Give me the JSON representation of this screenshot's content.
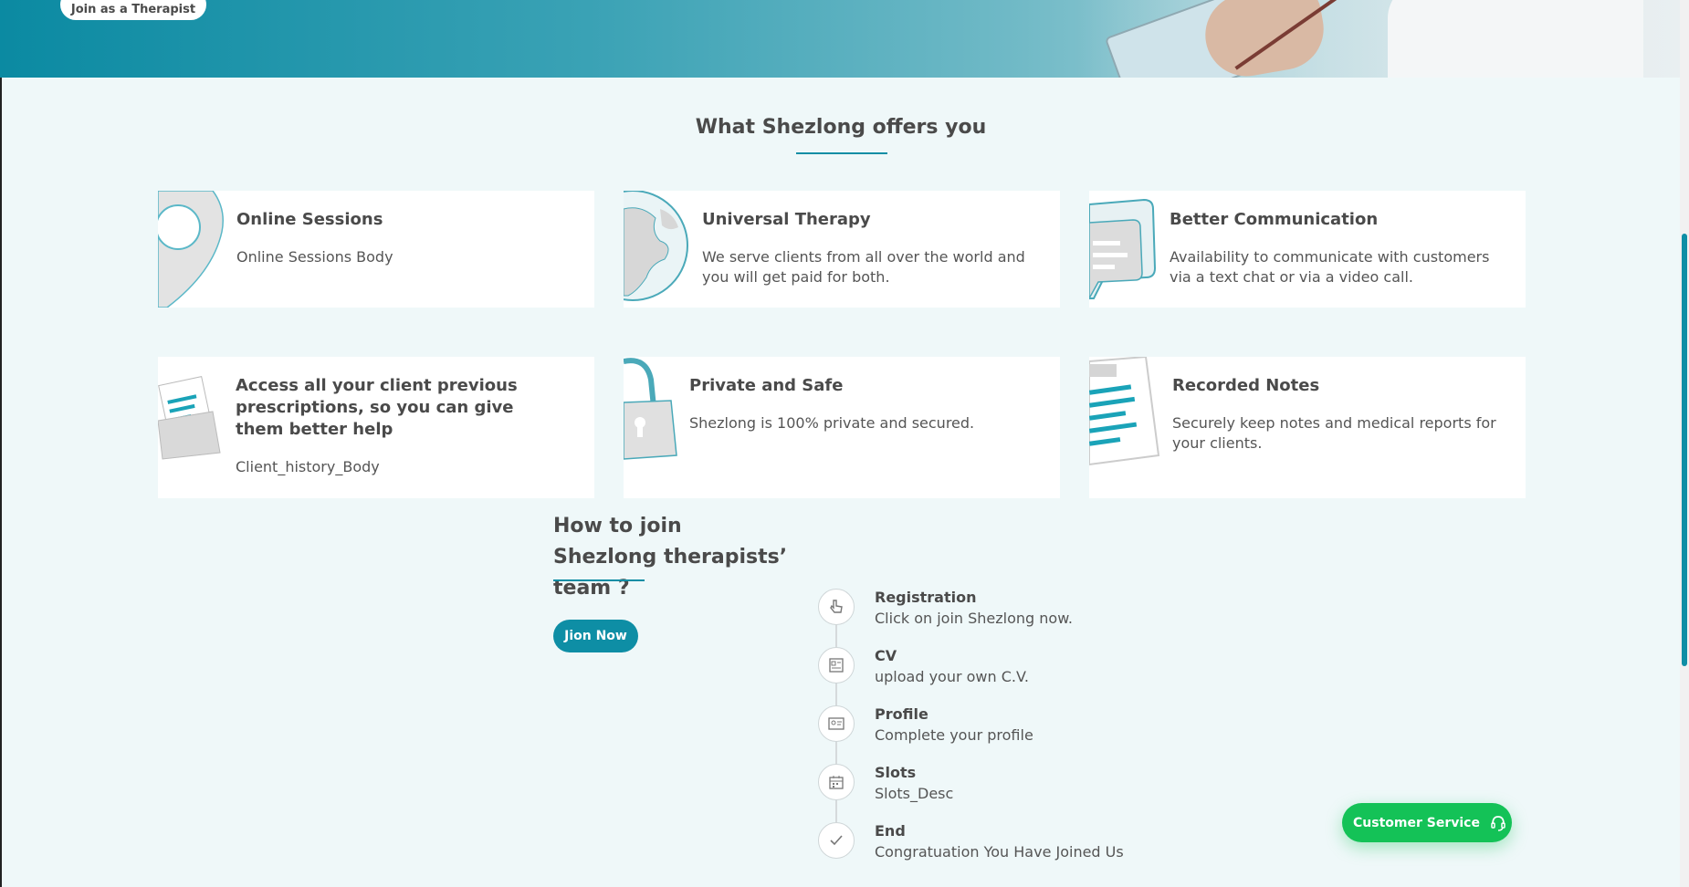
{
  "hero": {
    "join_button": "Join as a Therapist"
  },
  "offers": {
    "title": "What Shezlong offers you",
    "cards": [
      {
        "title": "Online Sessions",
        "body": "Online Sessions Body",
        "icon": "map-pin-icon"
      },
      {
        "title": "Universal Therapy",
        "body": "We serve clients from all over the world and you will get paid for both.",
        "icon": "globe-icon"
      },
      {
        "title": "Better Communication",
        "body": "Availability to communicate with customers via a text chat or via a video call.",
        "icon": "chat-bubbles-icon"
      },
      {
        "title": "Access all your client previous prescriptions, so you can give them better help",
        "body": "Client_history_Body",
        "icon": "folder-icon"
      },
      {
        "title": "Private and Safe",
        "body": "Shezlong is 100% private and secured.",
        "icon": "padlock-icon"
      },
      {
        "title": "Recorded Notes",
        "body": "Securely keep notes and medical reports for your clients.",
        "icon": "clipboard-notes-icon"
      }
    ]
  },
  "join": {
    "title": "How to join Shezlong therapists’ team ?",
    "button": "Jion Now",
    "steps": [
      {
        "title": "Registration",
        "desc": "Click on join Shezlong now.",
        "icon": "pointer-hand-icon"
      },
      {
        "title": "CV",
        "desc": "upload your own C.V.",
        "icon": "document-icon"
      },
      {
        "title": "Profile",
        "desc": "Complete your profile",
        "icon": "id-card-icon"
      },
      {
        "title": "Slots",
        "desc": "Slots_Desc",
        "icon": "calendar-icon"
      },
      {
        "title": "End",
        "desc": "Congratuation You Have Joined Us",
        "icon": "checkmark-icon"
      }
    ]
  },
  "customer_service": {
    "label": "Customer Service",
    "icon": "headset-icon"
  },
  "colors": {
    "accent": "#0e8ea5",
    "background": "#eff8f9",
    "cs_green": "#14c257"
  }
}
